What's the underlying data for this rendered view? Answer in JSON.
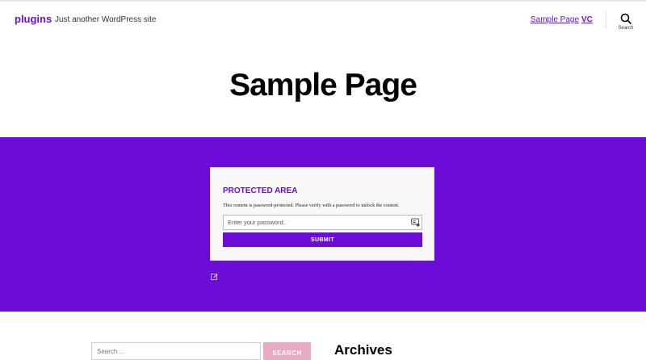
{
  "header": {
    "site_title": "plugins",
    "site_description": "Just another WordPress site",
    "nav": [
      {
        "label": "Sample Page"
      },
      {
        "label": "VC"
      }
    ],
    "search_label": "Search"
  },
  "page": {
    "title": "Sample Page"
  },
  "protected": {
    "heading": "PROTECTED AREA",
    "message": "This content is password-protected. Please verify with a password to unlock the content.",
    "password_placeholder": "Enter your password..",
    "submit_label": "SUBMIT"
  },
  "footer": {
    "search_placeholder": "Search ...",
    "search_button_label": "SEARCH",
    "archives_heading": "Archives"
  },
  "colors": {
    "accent": "#6c0cd8",
    "box_background": "#f8f8f8",
    "search_button": "#e8a9c2"
  },
  "icons": [
    "search-icon",
    "key-icon",
    "edit-icon"
  ]
}
